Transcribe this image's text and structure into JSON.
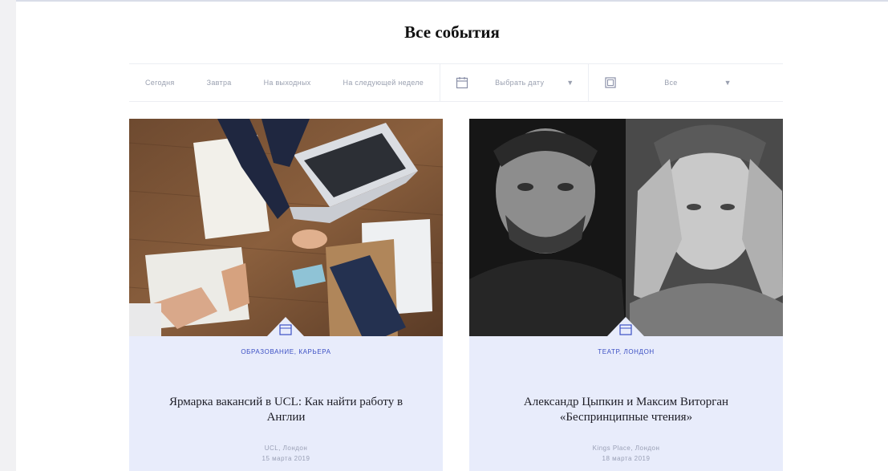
{
  "header": {
    "title": "Все события"
  },
  "filters": {
    "links": [
      "Сегодня",
      "Завтра",
      "На выходных",
      "На следующей неделе"
    ],
    "date_select": {
      "icon": "calendar-icon",
      "value": "Выбрать дату"
    },
    "category_select": {
      "icon": "grid-icon",
      "value": "Все"
    }
  },
  "cards": [
    {
      "image": "handshake-photo",
      "tag": "Образование, Карьера",
      "title": "Ярмарка вакансий в UCL: Как найти работу в Англии",
      "meta_line1": "UCL, Лондон",
      "meta_line2": "15 марта 2019"
    },
    {
      "image": "actors-portrait-photo",
      "tag": "Театр, Лондон",
      "title": "Александр Цыпкин и Максим Виторган «Беспринципные чтения»",
      "meta_line1": "Kings Place, Лондон",
      "meta_line2": "18 марта 2019"
    }
  ],
  "colors": {
    "card_bg": "#e8ecfb",
    "accent": "#3b4fc4",
    "muted": "#9aa0b0"
  }
}
